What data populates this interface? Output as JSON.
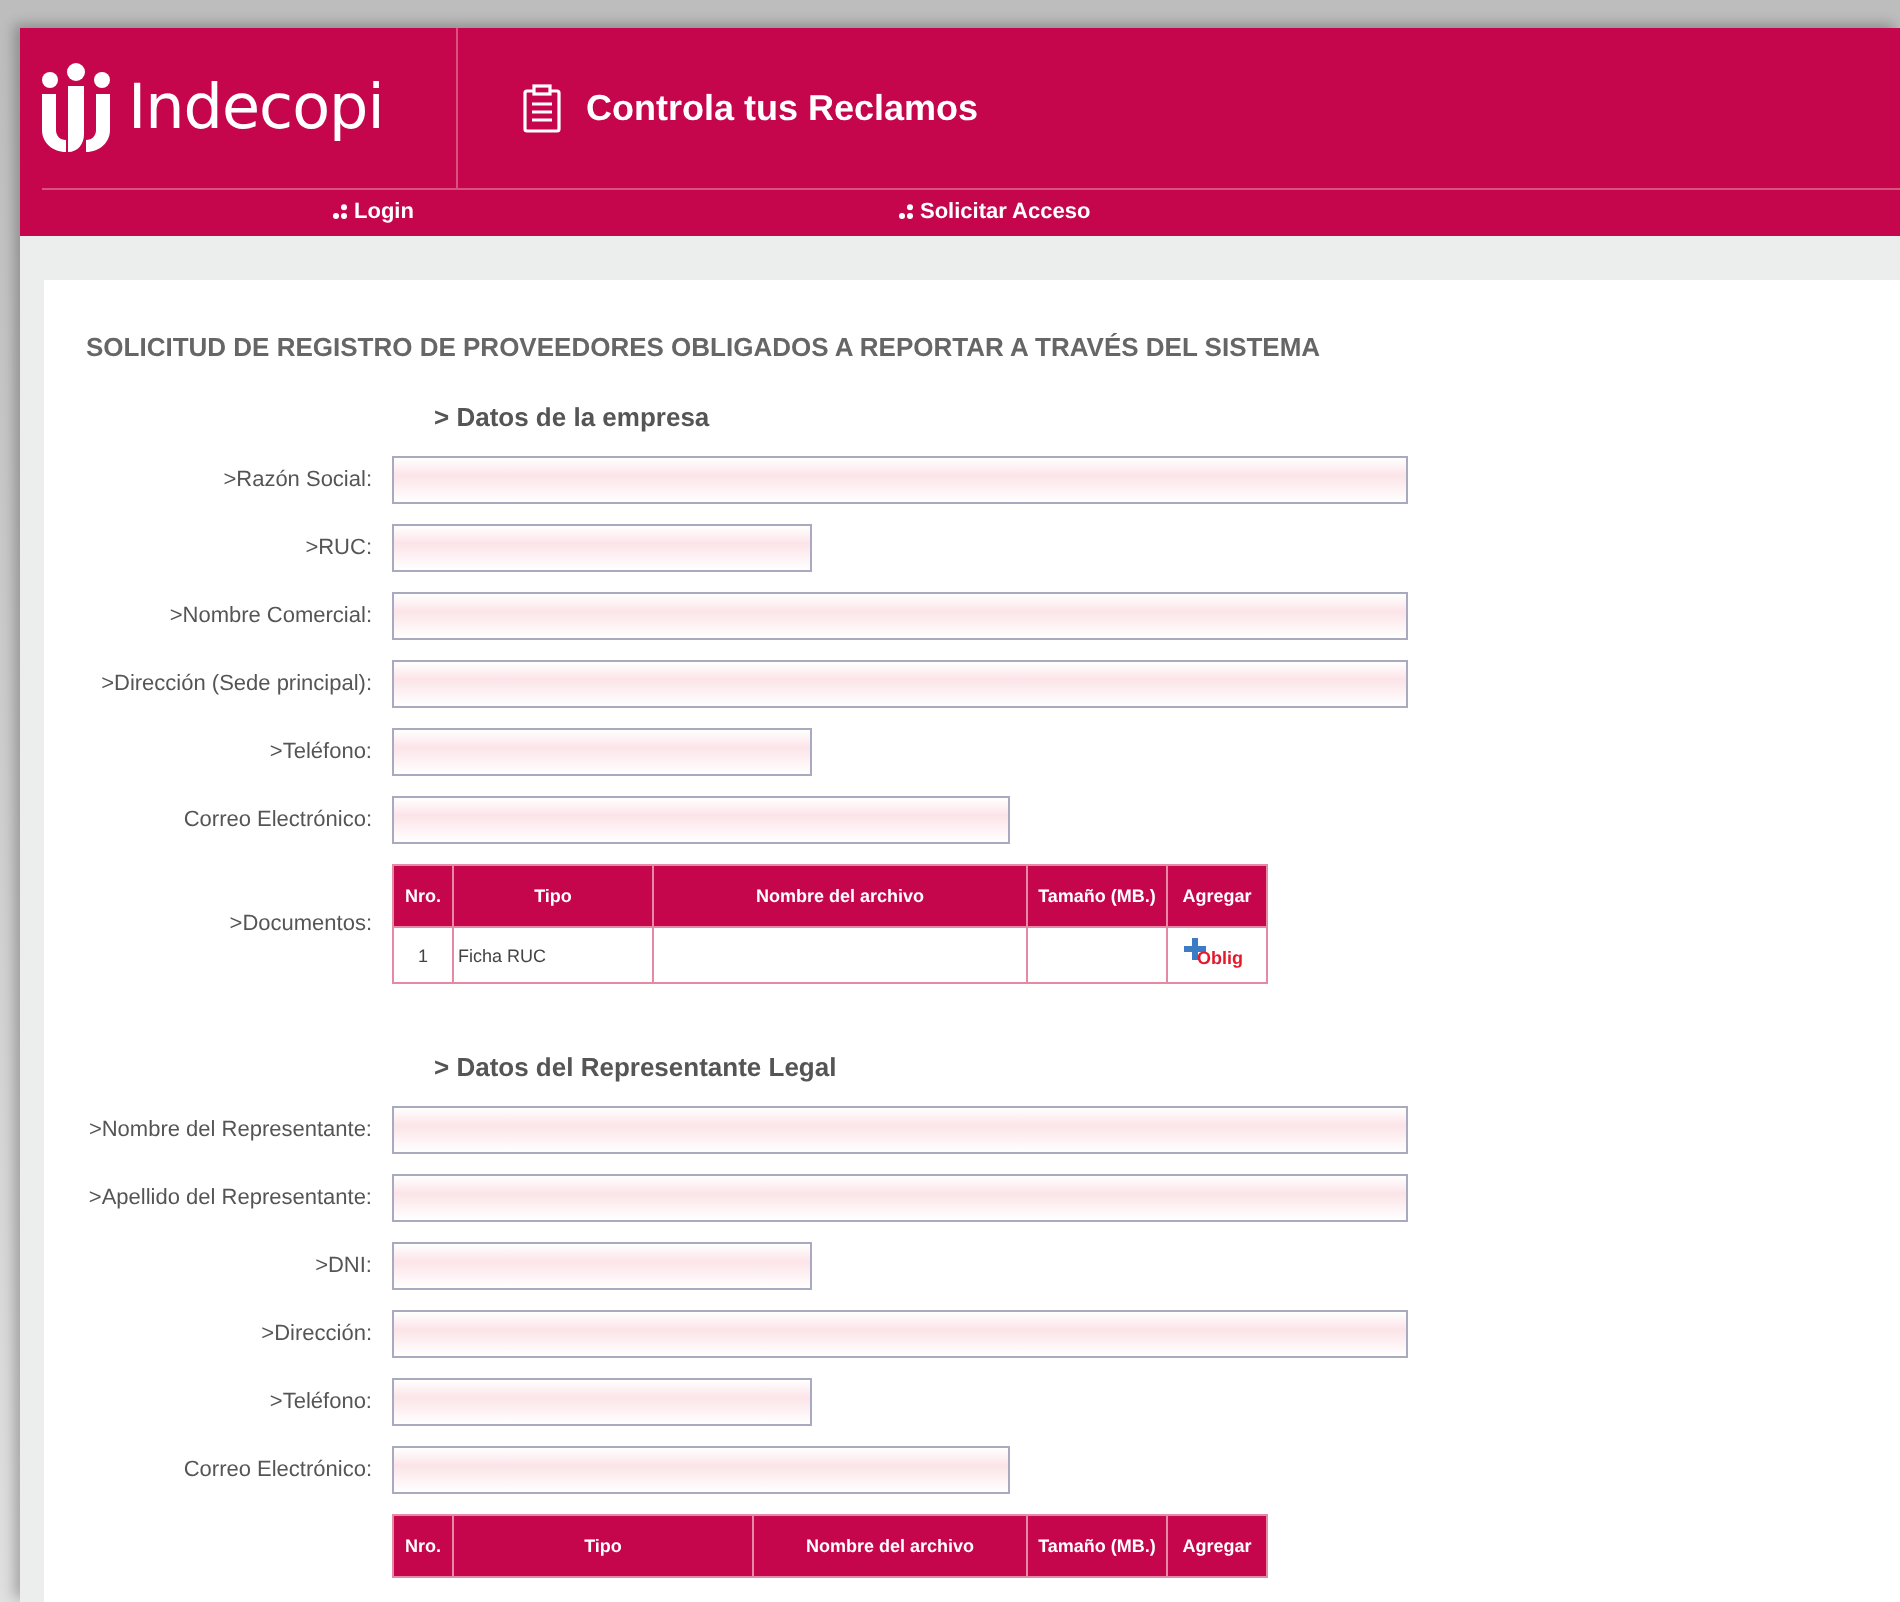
{
  "header": {
    "brand": "Indecopi",
    "app_title": "Controla tus Reclamos",
    "nav": [
      {
        "label": "Login"
      },
      {
        "label": "Solicitar Acceso"
      }
    ]
  },
  "page_title": "SOLICITUD DE REGISTRO DE PROVEEDORES OBLIGADOS A REPORTAR A TRAVÉS DEL SISTEMA",
  "sections": [
    {
      "heading": "> Datos de la empresa",
      "fields": [
        {
          "label": ">Razón Social:",
          "kind": "long"
        },
        {
          "label": ">RUC:",
          "kind": "short"
        },
        {
          "label": ">Nombre Comercial:",
          "kind": "long"
        },
        {
          "label": ">Dirección (Sede principal):",
          "kind": "long"
        },
        {
          "label": ">Teléfono:",
          "kind": "short"
        },
        {
          "label": "Correo Electrónico:",
          "kind": "medium"
        }
      ],
      "documents": {
        "label": ">Documentos:",
        "columns": [
          "Nro.",
          "Tipo",
          "Nombre del archivo",
          "Tamaño (MB.)",
          "Agregar"
        ],
        "rows": [
          {
            "nro": "1",
            "tipo": "Ficha RUC",
            "badge": "Oblig"
          }
        ]
      }
    },
    {
      "heading": "> Datos del Representante Legal",
      "fields": [
        {
          "label": ">Nombre del Representante:",
          "kind": "long"
        },
        {
          "label": ">Apellido del Representante:",
          "kind": "long"
        },
        {
          "label": ">DNI:",
          "kind": "short"
        },
        {
          "label": ">Dirección:",
          "kind": "long"
        },
        {
          "label": ">Teléfono:",
          "kind": "short"
        },
        {
          "label": "Correo Electrónico:",
          "kind": "medium"
        }
      ],
      "documents": {
        "columns": [
          "Nro.",
          "Tipo",
          "Nombre del archivo",
          "Tamaño (MB.)",
          "Agregar"
        ]
      }
    }
  ]
}
